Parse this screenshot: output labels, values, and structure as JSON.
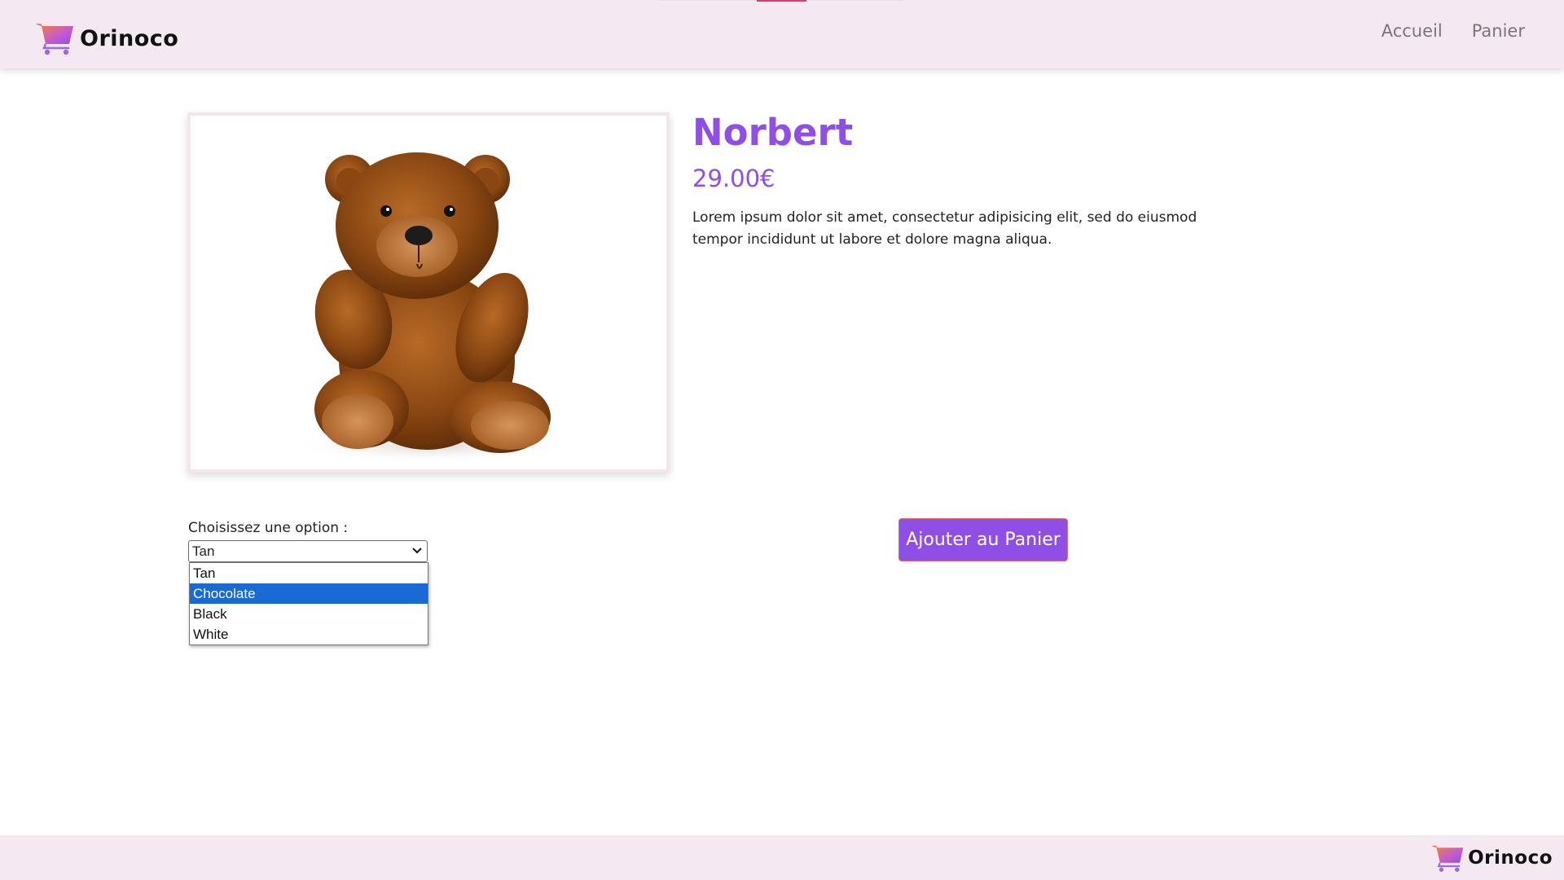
{
  "brand": {
    "name": "Orinoco",
    "colors": {
      "accent": "#8f4fe6",
      "header_bg": "#f4e9f1",
      "button_border": "#e06b5e",
      "selected_option": "#1a6ad6"
    }
  },
  "header": {
    "logo_icon": "shopping-cart-icon",
    "nav": [
      {
        "label": "Accueil"
      },
      {
        "label": "Panier"
      }
    ]
  },
  "product": {
    "image": "teddy-bear-image",
    "name": "Norbert",
    "price": "29.00€",
    "description": "Lorem ipsum dolor sit amet, consectetur adipisicing elit, sed do eiusmod tempor incididunt ut labore et dolore magna aliqua."
  },
  "options": {
    "label": "Choisissez une option :",
    "selected_value": "Tan",
    "highlighted": "Chocolate",
    "items": [
      "Tan",
      "Chocolate",
      "Black",
      "White"
    ],
    "dropdown_open": true
  },
  "actions": {
    "add_to_cart_label": "Ajouter au Panier"
  },
  "footer": {
    "logo_icon": "shopping-cart-icon",
    "brand_name": "Orinoco"
  }
}
